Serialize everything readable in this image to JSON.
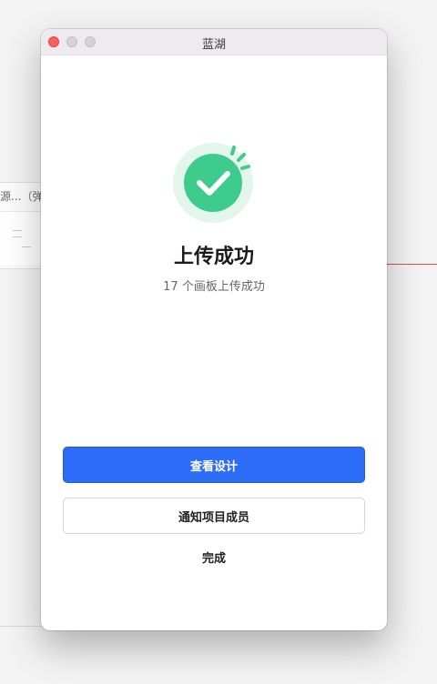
{
  "background": {
    "panel_title": "源...（弹窗"
  },
  "window": {
    "title": "蓝湖"
  },
  "status": {
    "icon": "checkmark-success-icon",
    "headline": "上传成功",
    "detail": "17 个画板上传成功"
  },
  "actions": {
    "view_design": "查看设计",
    "notify_members": "通知项目成员",
    "done": "完成"
  },
  "colors": {
    "accent": "#2d6cf6",
    "success": "#3ecb8e",
    "success_bg": "#e2f6ec"
  }
}
